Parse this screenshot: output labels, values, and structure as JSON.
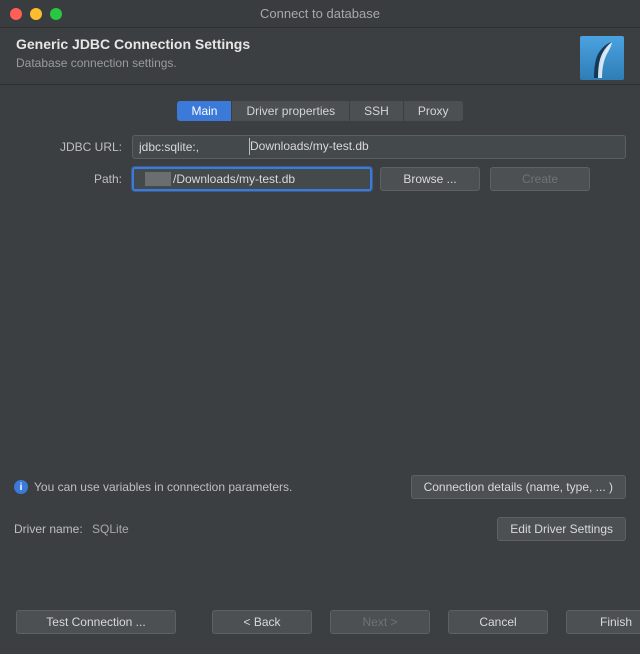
{
  "window": {
    "title": "Connect to database"
  },
  "header": {
    "title": "Generic JDBC Connection Settings",
    "subtitle": "Database connection settings."
  },
  "tabs": {
    "items": [
      {
        "label": "Main",
        "active": true
      },
      {
        "label": "Driver properties",
        "active": false
      },
      {
        "label": "SSH",
        "active": false
      },
      {
        "label": "Proxy",
        "active": false
      }
    ]
  },
  "form": {
    "jdbc_label": "JDBC URL:",
    "jdbc_value_part1": "jdbc:sqlite:,",
    "jdbc_value_part2": "Downloads/my-test.db",
    "path_label": "Path:",
    "path_value_suffix": "/Downloads/my-test.db",
    "browse_label": "Browse ...",
    "create_label": "Create"
  },
  "info": {
    "text": "You can use variables in connection parameters.",
    "details_button": "Connection details (name, type, ... )"
  },
  "driver": {
    "label": "Driver name:",
    "value": "SQLite",
    "edit_button": "Edit Driver Settings"
  },
  "footer": {
    "test": "Test Connection ...",
    "back": "< Back",
    "next": "Next >",
    "cancel": "Cancel",
    "finish": "Finish"
  }
}
